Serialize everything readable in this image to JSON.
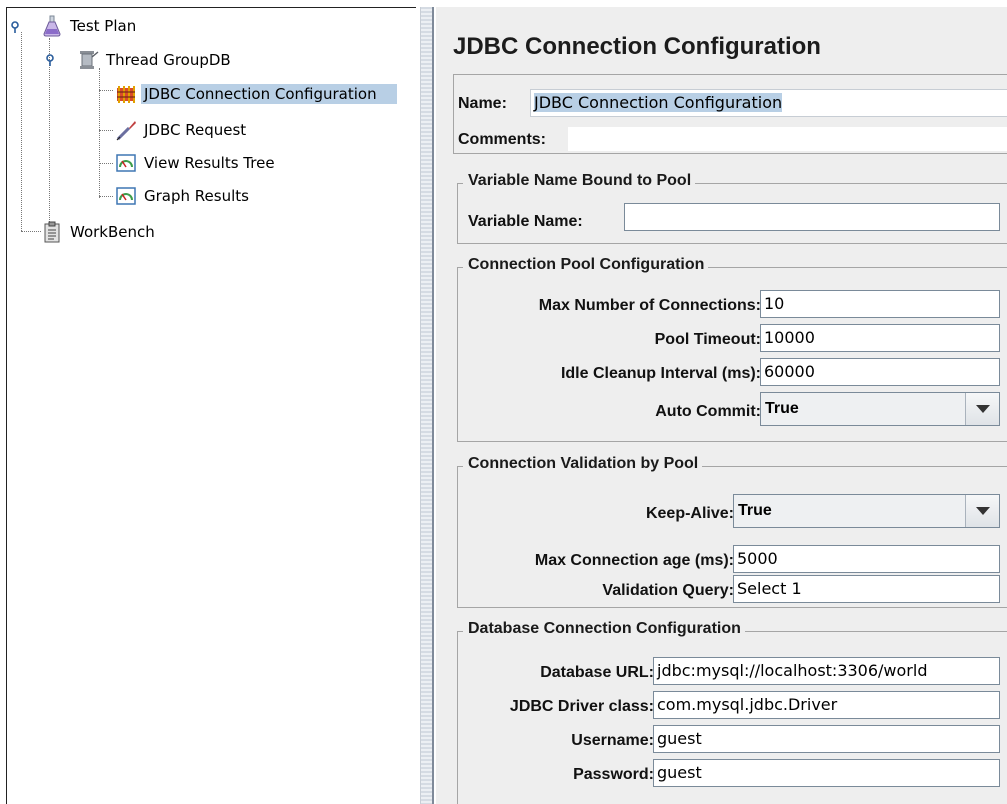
{
  "tree": {
    "items": [
      {
        "label": "Test Plan",
        "icon": "flask-icon"
      },
      {
        "label": "Thread GroupDB",
        "icon": "spool-icon"
      },
      {
        "label": "JDBC Connection Configuration",
        "icon": "wrench-tools-icon"
      },
      {
        "label": "JDBC Request",
        "icon": "pipette-icon"
      },
      {
        "label": "View Results Tree",
        "icon": "gauge-icon"
      },
      {
        "label": "Graph Results",
        "icon": "gauge-icon"
      },
      {
        "label": "WorkBench",
        "icon": "clipboard-icon"
      }
    ]
  },
  "panel": {
    "title": "JDBC Connection Configuration",
    "name_label": "Name:",
    "name_value": "JDBC Connection Configuration",
    "comments_label": "Comments:",
    "comments_value": "",
    "var_group": {
      "title": "Variable Name Bound to Pool",
      "variable_name_label": "Variable Name:",
      "variable_name_value": ""
    },
    "pool_group": {
      "title": "Connection Pool Configuration",
      "max_conn_label": "Max Number of Connections:",
      "max_conn_value": "10",
      "pool_timeout_label": "Pool Timeout:",
      "pool_timeout_value": "10000",
      "idle_label": "Idle Cleanup Interval (ms):",
      "idle_value": "60000",
      "auto_commit_label": "Auto Commit:",
      "auto_commit_value": "True"
    },
    "validation_group": {
      "title": "Connection Validation by Pool",
      "keep_alive_label": "Keep-Alive:",
      "keep_alive_value": "True",
      "max_age_label": "Max Connection age (ms):",
      "max_age_value": "5000",
      "query_label": "Validation Query:",
      "query_value": "Select 1"
    },
    "db_group": {
      "title": "Database Connection Configuration",
      "url_label": "Database URL:",
      "url_value": "jdbc:mysql://localhost:3306/world",
      "driver_label": "JDBC Driver class:",
      "driver_value": "com.mysql.jdbc.Driver",
      "username_label": "Username:",
      "username_value": "guest",
      "password_label": "Password:",
      "password_value": "guest"
    }
  },
  "colors": {
    "selection": "#b8cfe5",
    "panel_bg": "#eeeeee",
    "border": "#a5a5a5"
  }
}
